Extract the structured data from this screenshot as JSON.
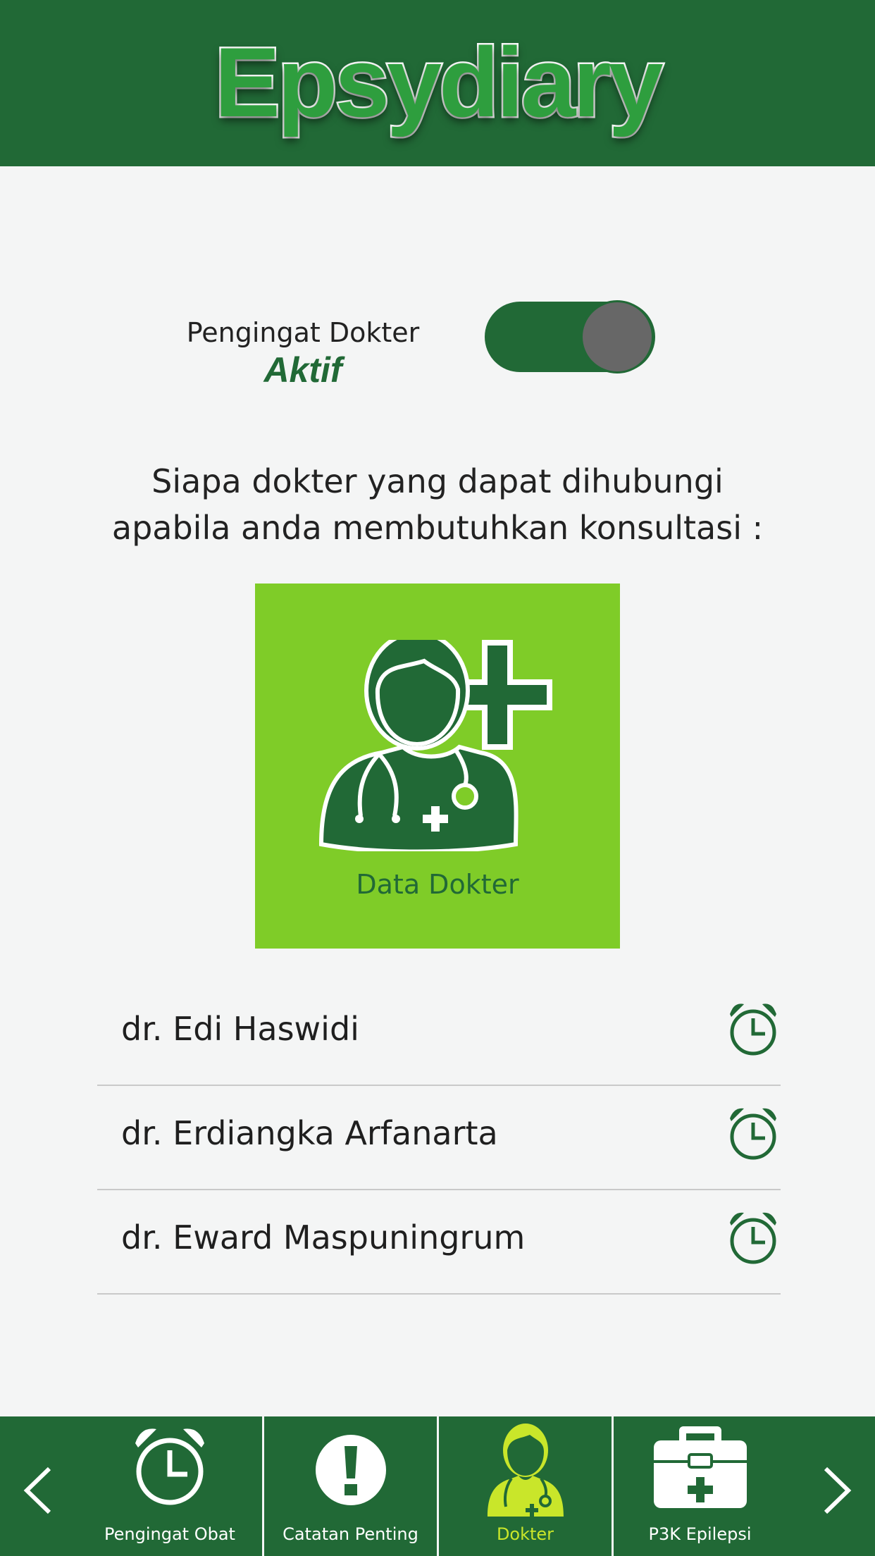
{
  "header": {
    "app_title": "Epsydiary"
  },
  "reminder": {
    "label": "Pengingat Dokter",
    "status": "Aktif",
    "toggle_on": true
  },
  "question": {
    "line1": "Siapa dokter yang dapat dihubungi",
    "line2": "apabila anda membutuhkan konsultasi :"
  },
  "tile": {
    "label": "Data Dokter",
    "icon": "doctor-add-icon"
  },
  "doctors": [
    {
      "name": "dr. Edi Haswidi",
      "icon": "alarm-clock-icon"
    },
    {
      "name": "dr. Erdiangka Arfanarta",
      "icon": "alarm-clock-icon"
    },
    {
      "name": "dr. Eward Maspuningrum",
      "icon": "alarm-clock-icon"
    }
  ],
  "bottom_nav": {
    "items": [
      {
        "label": "Pengingat Obat",
        "icon": "alarm-clock-icon",
        "active": false
      },
      {
        "label": "Catatan Penting",
        "icon": "exclamation-icon",
        "active": false
      },
      {
        "label": "Dokter",
        "icon": "doctor-icon",
        "active": true
      },
      {
        "label": "P3K Epilepsi",
        "icon": "first-aid-kit-icon",
        "active": false
      }
    ]
  },
  "colors": {
    "primary": "#216936",
    "accent": "#7fcc28",
    "active_nav": "#c9e62a",
    "background": "#f4f5f5"
  }
}
